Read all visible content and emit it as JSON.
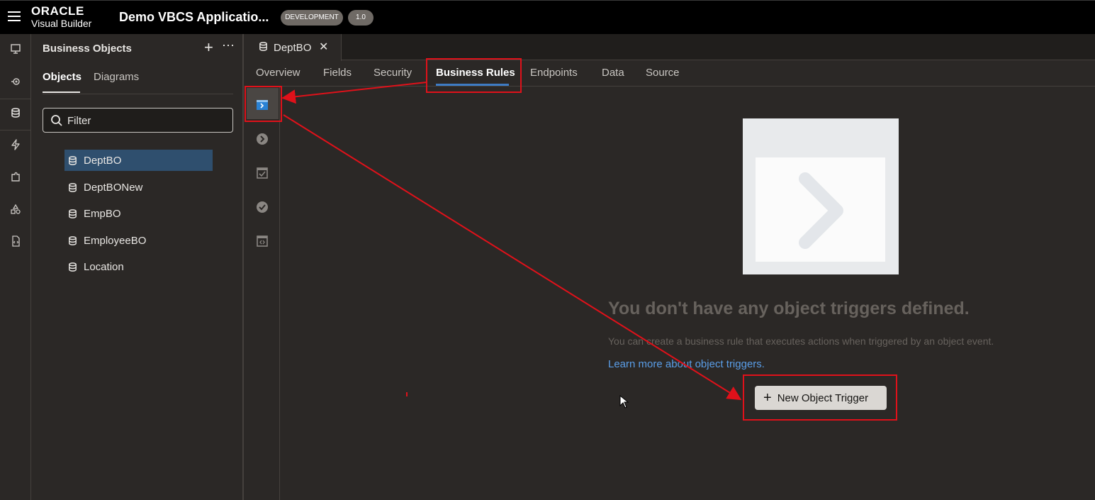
{
  "header": {
    "brand_line1": "ORACLE",
    "brand_line2": "Visual Builder",
    "app_title": "Demo VBCS Applicatio...",
    "env_badge": "DEVELOPMENT",
    "version_badge": "1.0"
  },
  "rail": {
    "icons": [
      "monitor-icon",
      "service-icon",
      "database-icon",
      "lightning-icon",
      "puzzle-icon",
      "components-icon",
      "source-file-icon"
    ]
  },
  "panel": {
    "title": "Business Objects",
    "add_label": "+",
    "more_label": "⋯",
    "tabs": [
      {
        "label": "Objects",
        "active": true
      },
      {
        "label": "Diagrams",
        "active": false
      }
    ],
    "filter_placeholder": "Filter",
    "items": [
      {
        "label": "DeptBO",
        "selected": true
      },
      {
        "label": "DeptBONew",
        "selected": false
      },
      {
        "label": "EmpBO",
        "selected": false
      },
      {
        "label": "EmployeeBO",
        "selected": false
      },
      {
        "label": "Location",
        "selected": false
      }
    ]
  },
  "editor": {
    "tab_label": "DeptBO",
    "tab_close": "✕",
    "subnav": [
      {
        "label": "Overview",
        "active": false
      },
      {
        "label": "Fields",
        "active": false
      },
      {
        "label": "Security",
        "active": false
      },
      {
        "label": "Business Rules",
        "active": true
      },
      {
        "label": "Endpoints",
        "active": false
      },
      {
        "label": "Data",
        "active": false
      },
      {
        "label": "Source",
        "active": false
      }
    ],
    "side_icons": [
      "object-triggers-icon",
      "field-triggers-icon",
      "object-validators-icon",
      "field-validators-icon",
      "object-functions-icon"
    ]
  },
  "empty_state": {
    "title": "You don't have any object triggers defined.",
    "description": "You can create a business rule that executes actions when triggered by an object event.",
    "link": "Learn more about object triggers.",
    "button_label": "New Object Trigger"
  },
  "colors": {
    "accent": "#3e7bc4",
    "highlight_box": "#e0111a",
    "link": "#5a9ee8",
    "background": "#2b2826"
  }
}
